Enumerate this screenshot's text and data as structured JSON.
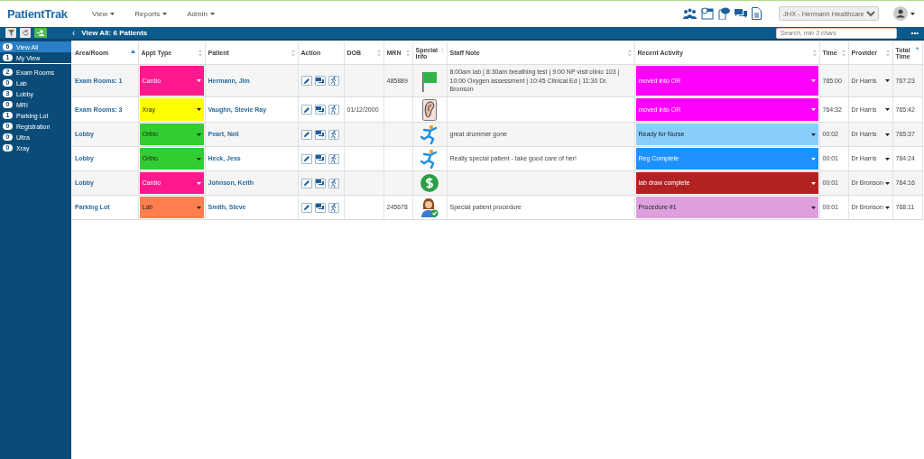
{
  "header": {
    "logo": "PatientTrak",
    "menus": [
      {
        "label": "View"
      },
      {
        "label": "Reports"
      },
      {
        "label": "Admin"
      }
    ],
    "organization": "JHX - Hermann Healthcare"
  },
  "toolbar": {
    "title": "View All: 6 Patients",
    "back": "‹",
    "search": {
      "placeholder": "Search, min 3 chars"
    },
    "more": "•••"
  },
  "sidebar": {
    "items": [
      {
        "count": "6",
        "label": "View All",
        "selected": true
      },
      {
        "count": "1",
        "label": "My View",
        "selected": false
      },
      {
        "count": "2",
        "label": "Exam Rooms",
        "selected": false
      },
      {
        "count": "0",
        "label": "Lab",
        "selected": false
      },
      {
        "count": "3",
        "label": "Lobby",
        "selected": false
      },
      {
        "count": "0",
        "label": "MRI",
        "selected": false
      },
      {
        "count": "1",
        "label": "Parking Lot",
        "selected": false
      },
      {
        "count": "0",
        "label": "Registration",
        "selected": false
      },
      {
        "count": "0",
        "label": "Ultra",
        "selected": false
      },
      {
        "count": "0",
        "label": "Xray",
        "selected": false
      }
    ]
  },
  "table": {
    "columns": [
      {
        "label": "Area/Room",
        "kind": "ascending"
      },
      {
        "label": "Appt Type",
        "kind": "sortable"
      },
      {
        "label": "Patient",
        "kind": "sortable"
      },
      {
        "label": "Action",
        "kind": "plain"
      },
      {
        "label": "DOB",
        "kind": "sortable"
      },
      {
        "label": "MRN",
        "kind": "sortable"
      },
      {
        "label": "Special Info",
        "kind": "sortable"
      },
      {
        "label": "Staff Note",
        "kind": "sortable"
      },
      {
        "label": "Recent Activity",
        "kind": "sortable"
      },
      {
        "label": "Time",
        "kind": "sortable"
      },
      {
        "label": "Provider",
        "kind": "sortable"
      },
      {
        "label": "Total Time",
        "kind": "descending"
      }
    ],
    "rows": [
      {
        "area": "Exam Rooms: 1",
        "appt_type": {
          "label": "Cardio",
          "color": "#fe1a8e"
        },
        "patient": "Hermann, Jim",
        "mrn": "485889",
        "special_info": {
          "kind": "flag"
        },
        "staff_note": "8:00am lab | 8:30am breathing test | 9:00 NP visit clinic 103 | 10:00 Oxygen assessment | 10:45 Clinical Ed | 11:30 Dr. Bronson",
        "recent_activity": {
          "label": "moved into OR",
          "color": "#ff00ff"
        },
        "time": "765:00",
        "provider": "Dr Harris",
        "total_time": "767:23"
      },
      {
        "area": "Exam Rooms: 3",
        "appt_type": {
          "label": "Xray",
          "color": "#ffff00"
        },
        "patient": "Vaughn, Stevie Ray",
        "dob": "01/12/2000",
        "special_info": {
          "kind": "ear"
        },
        "recent_activity": {
          "label": "moved into OR",
          "color": "#ff00ff"
        },
        "time": "764:32",
        "provider": "Dr Harris",
        "total_time": "765:42"
      },
      {
        "area": "Lobby",
        "appt_type": {
          "label": "Ortho",
          "color": "#32cd32"
        },
        "patient": "Peart, Neil",
        "special_info": {
          "kind": "fall"
        },
        "staff_note": "great drummer gone",
        "recent_activity": {
          "label": "Ready for Nurse",
          "color": "#87cefa"
        },
        "time": "00:02",
        "provider": "Dr Harris",
        "total_time": "765:37"
      },
      {
        "area": "Lobby",
        "appt_type": {
          "label": "Ortho",
          "color": "#32cd32"
        },
        "patient": "Heck, Jess",
        "special_info": {
          "kind": "fall"
        },
        "staff_note": "Really special patient - take good care of her!",
        "recent_activity": {
          "label": "Reg Complete",
          "color": "#1e90ff"
        },
        "time": "00:01",
        "provider": "Dr Harris",
        "total_time": "764:24"
      },
      {
        "area": "Lobby",
        "appt_type": {
          "label": "Cardio",
          "color": "#fe1a8e"
        },
        "patient": "Johnson, Keith",
        "special_info": {
          "kind": "dollar"
        },
        "recent_activity": {
          "label": "lab draw complete",
          "color": "#b22222"
        },
        "time": "00:01",
        "provider": "Dr Bronson",
        "total_time": "764:16"
      },
      {
        "area": "Parking Lot",
        "appt_type": {
          "label": "Lab",
          "color": "#ff7f50"
        },
        "patient": "Smith, Steve",
        "mrn": "245678",
        "special_info": {
          "kind": "person-check"
        },
        "staff_note": "Special patient procedure",
        "recent_activity": {
          "label": "Procedure #1",
          "color": "#dda0dd"
        },
        "time": "00:01",
        "provider": "Dr Bronson",
        "total_time": "768:11"
      }
    ]
  }
}
